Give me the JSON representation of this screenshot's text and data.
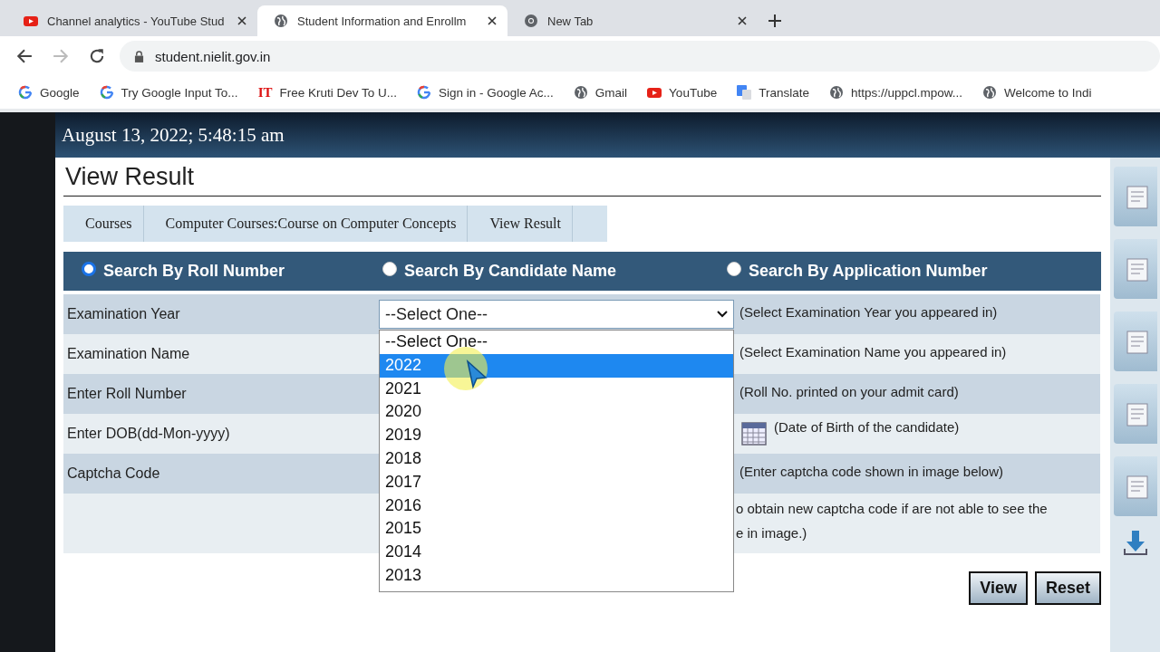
{
  "tabs": [
    {
      "title": "Channel analytics - YouTube Stud",
      "kind": "youtube",
      "selected": false
    },
    {
      "title": "Student Information and Enrollm",
      "kind": "globe",
      "selected": true
    },
    {
      "title": "New Tab",
      "kind": "chrome",
      "selected": false
    }
  ],
  "address": "student.nielit.gov.in",
  "bookmarks": [
    {
      "label": "Google",
      "kind": "google"
    },
    {
      "label": "Try Google Input To...",
      "kind": "google"
    },
    {
      "label": "Free Kruti Dev To U...",
      "kind": "text-logo",
      "logo": "IT"
    },
    {
      "label": "Sign in - Google Ac...",
      "kind": "google"
    },
    {
      "label": "Gmail",
      "kind": "globe"
    },
    {
      "label": "YouTube",
      "kind": "youtube"
    },
    {
      "label": "Translate",
      "kind": "translate"
    },
    {
      "label": "https://uppcl.mpow...",
      "kind": "globe"
    },
    {
      "label": "Welcome to Indi",
      "kind": "globe"
    }
  ],
  "datetime": "August 13, 2022; 5:48:15 am",
  "title": "View Result",
  "breadcrumb": [
    "Courses",
    "Computer Courses:Course on Computer Concepts",
    "View Result"
  ],
  "search_options": [
    {
      "label": "Search By Roll Number",
      "selected": true
    },
    {
      "label": "Search By Candidate Name",
      "selected": false
    },
    {
      "label": "Search By Application Number",
      "selected": false
    }
  ],
  "form_rows": [
    {
      "label": "Examination Year",
      "kind": "select",
      "value": "--Select One--",
      "hint": "(Select Examination Year you appeared in)"
    },
    {
      "label": "Examination Name",
      "kind": "hidden",
      "hint": "(Select Examination Name you appeared in)"
    },
    {
      "label": "Enter Roll Number",
      "kind": "hidden",
      "hint": "(Roll No. printed on your admit card)"
    },
    {
      "label": "Enter DOB(dd-Mon-yyyy)",
      "kind": "date",
      "hint": "(Date of Birth of the candidate)"
    },
    {
      "label": "Captcha Code",
      "kind": "hidden",
      "hint": "(Enter captcha code shown in image below)"
    },
    {
      "kind": "note",
      "hint_lines": [
        "o obtain new captcha code if are not able to see the",
        "e in image.)"
      ]
    }
  ],
  "dropdown": [
    {
      "label": "--Select One--",
      "selected": false
    },
    {
      "label": "2022",
      "selected": true
    },
    {
      "label": "2021",
      "selected": false
    },
    {
      "label": "2020",
      "selected": false
    },
    {
      "label": "2019",
      "selected": false
    },
    {
      "label": "2018",
      "selected": false
    },
    {
      "label": "2017",
      "selected": false
    },
    {
      "label": "2016",
      "selected": false
    },
    {
      "label": "2015",
      "selected": false
    },
    {
      "label": "2014",
      "selected": false
    },
    {
      "label": "2013",
      "selected": false
    }
  ],
  "buttons": [
    "View",
    "Reset"
  ]
}
